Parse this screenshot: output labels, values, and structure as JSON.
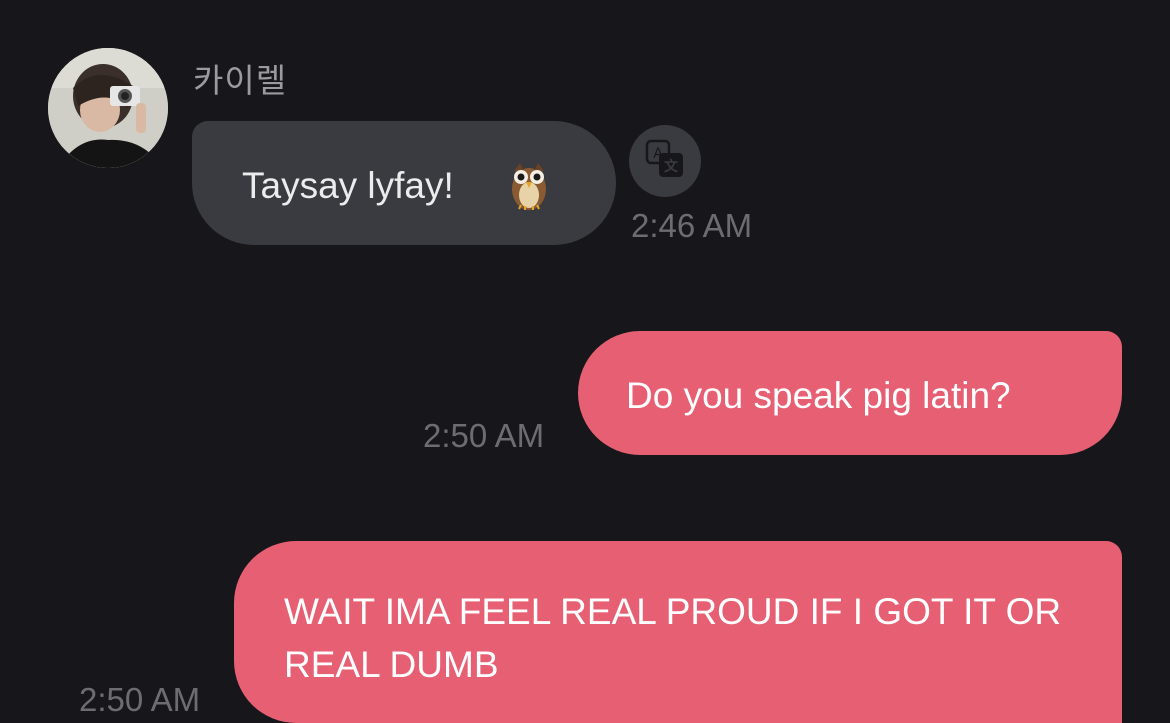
{
  "conversation": {
    "sender_name": "카이렐",
    "avatar_icon": "user-avatar",
    "messages": [
      {
        "direction": "incoming",
        "text": "Taysay lyfay!",
        "emoji": "owl-emoji",
        "time": "2:46 AM",
        "action_icon": "translate-icon"
      },
      {
        "direction": "outgoing",
        "text": "Do you speak pig latin?",
        "time": "2:50 AM"
      },
      {
        "direction": "outgoing",
        "text": "WAIT IMA FEEL REAL PROUD IF I GOT IT OR REAL DUMB",
        "time": "2:50 AM"
      }
    ]
  },
  "colors": {
    "background": "#17171b",
    "incoming_bubble": "#3a3b40",
    "outgoing_bubble": "#e65f73",
    "timestamp": "#6c6c72"
  }
}
